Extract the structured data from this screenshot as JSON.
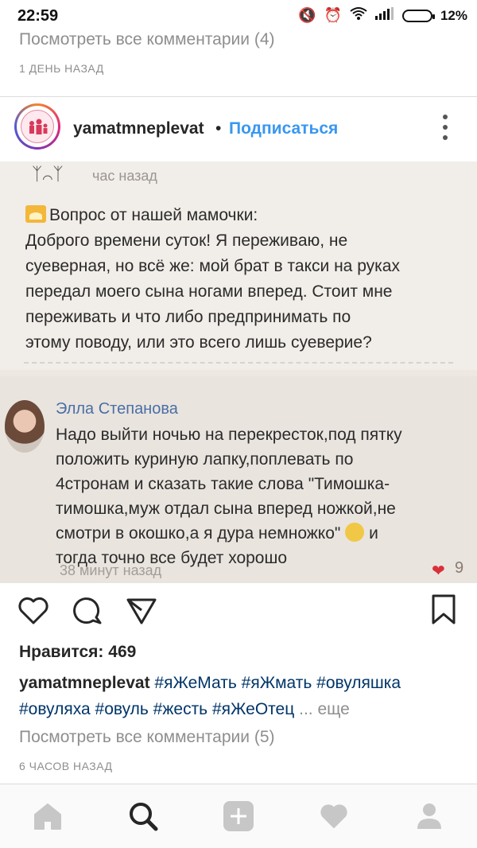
{
  "status_bar": {
    "time": "22:59",
    "battery": "12%"
  },
  "prev_post": {
    "view_comments": "Посмотреть все комментарии (4)",
    "time_ago": "1 ДЕНЬ НАЗАД"
  },
  "post": {
    "username": "yamatmneplevat",
    "separator": "•",
    "follow_label": "Подписаться",
    "photo": {
      "time_ago": "час назад",
      "question_title": "Вопрос от нашей мамочки:",
      "question_lines": [
        "Доброго времени суток! Я переживаю, не",
        "суеверная, но всё же: мой брат в такси на руках",
        "передал моего сына   ногами вперед. Стоит мне",
        "переживать и что либо предпринимать по",
        "этому поводу, или это всего лишь суеверие?"
      ],
      "reply_name": "Элла Степанова",
      "reply_lines": [
        "Надо выйти ночью на перекресток,под пятку",
        "положить куриную лапку,поплевать по",
        "4стронам и сказать такие слова \"Тимошка-",
        "тимошка,муж отдал сына вперед ножкой,не",
        "смотри в окошко,а я дура немножко\"",
        "и",
        "тогда точно все будет хорошо"
      ],
      "reply_time": "38 минут назад",
      "reply_likes": "9"
    },
    "likes_label": "Нравится: 469",
    "caption": {
      "username": "yamatmneplevat",
      "hashtags": [
        "#яЖеМать",
        "#яЖмать",
        "#овуляшка",
        "#овуляха",
        "#овуль",
        "#жесть",
        "#яЖеОтец"
      ],
      "more": "... еще"
    },
    "view_comments": "Посмотреть все комментарии (5)",
    "time_ago": "6 ЧАСОВ НАЗАД"
  },
  "icons": {
    "actions": [
      "heart-icon",
      "comment-icon",
      "share-icon",
      "bookmark-icon"
    ],
    "tabbar": [
      "home-icon",
      "search-icon",
      "add-icon",
      "activity-icon",
      "profile-icon"
    ]
  },
  "colors": {
    "link_blue": "#3897f0",
    "hashtag": "#003569",
    "muted": "#8e8e8e"
  }
}
